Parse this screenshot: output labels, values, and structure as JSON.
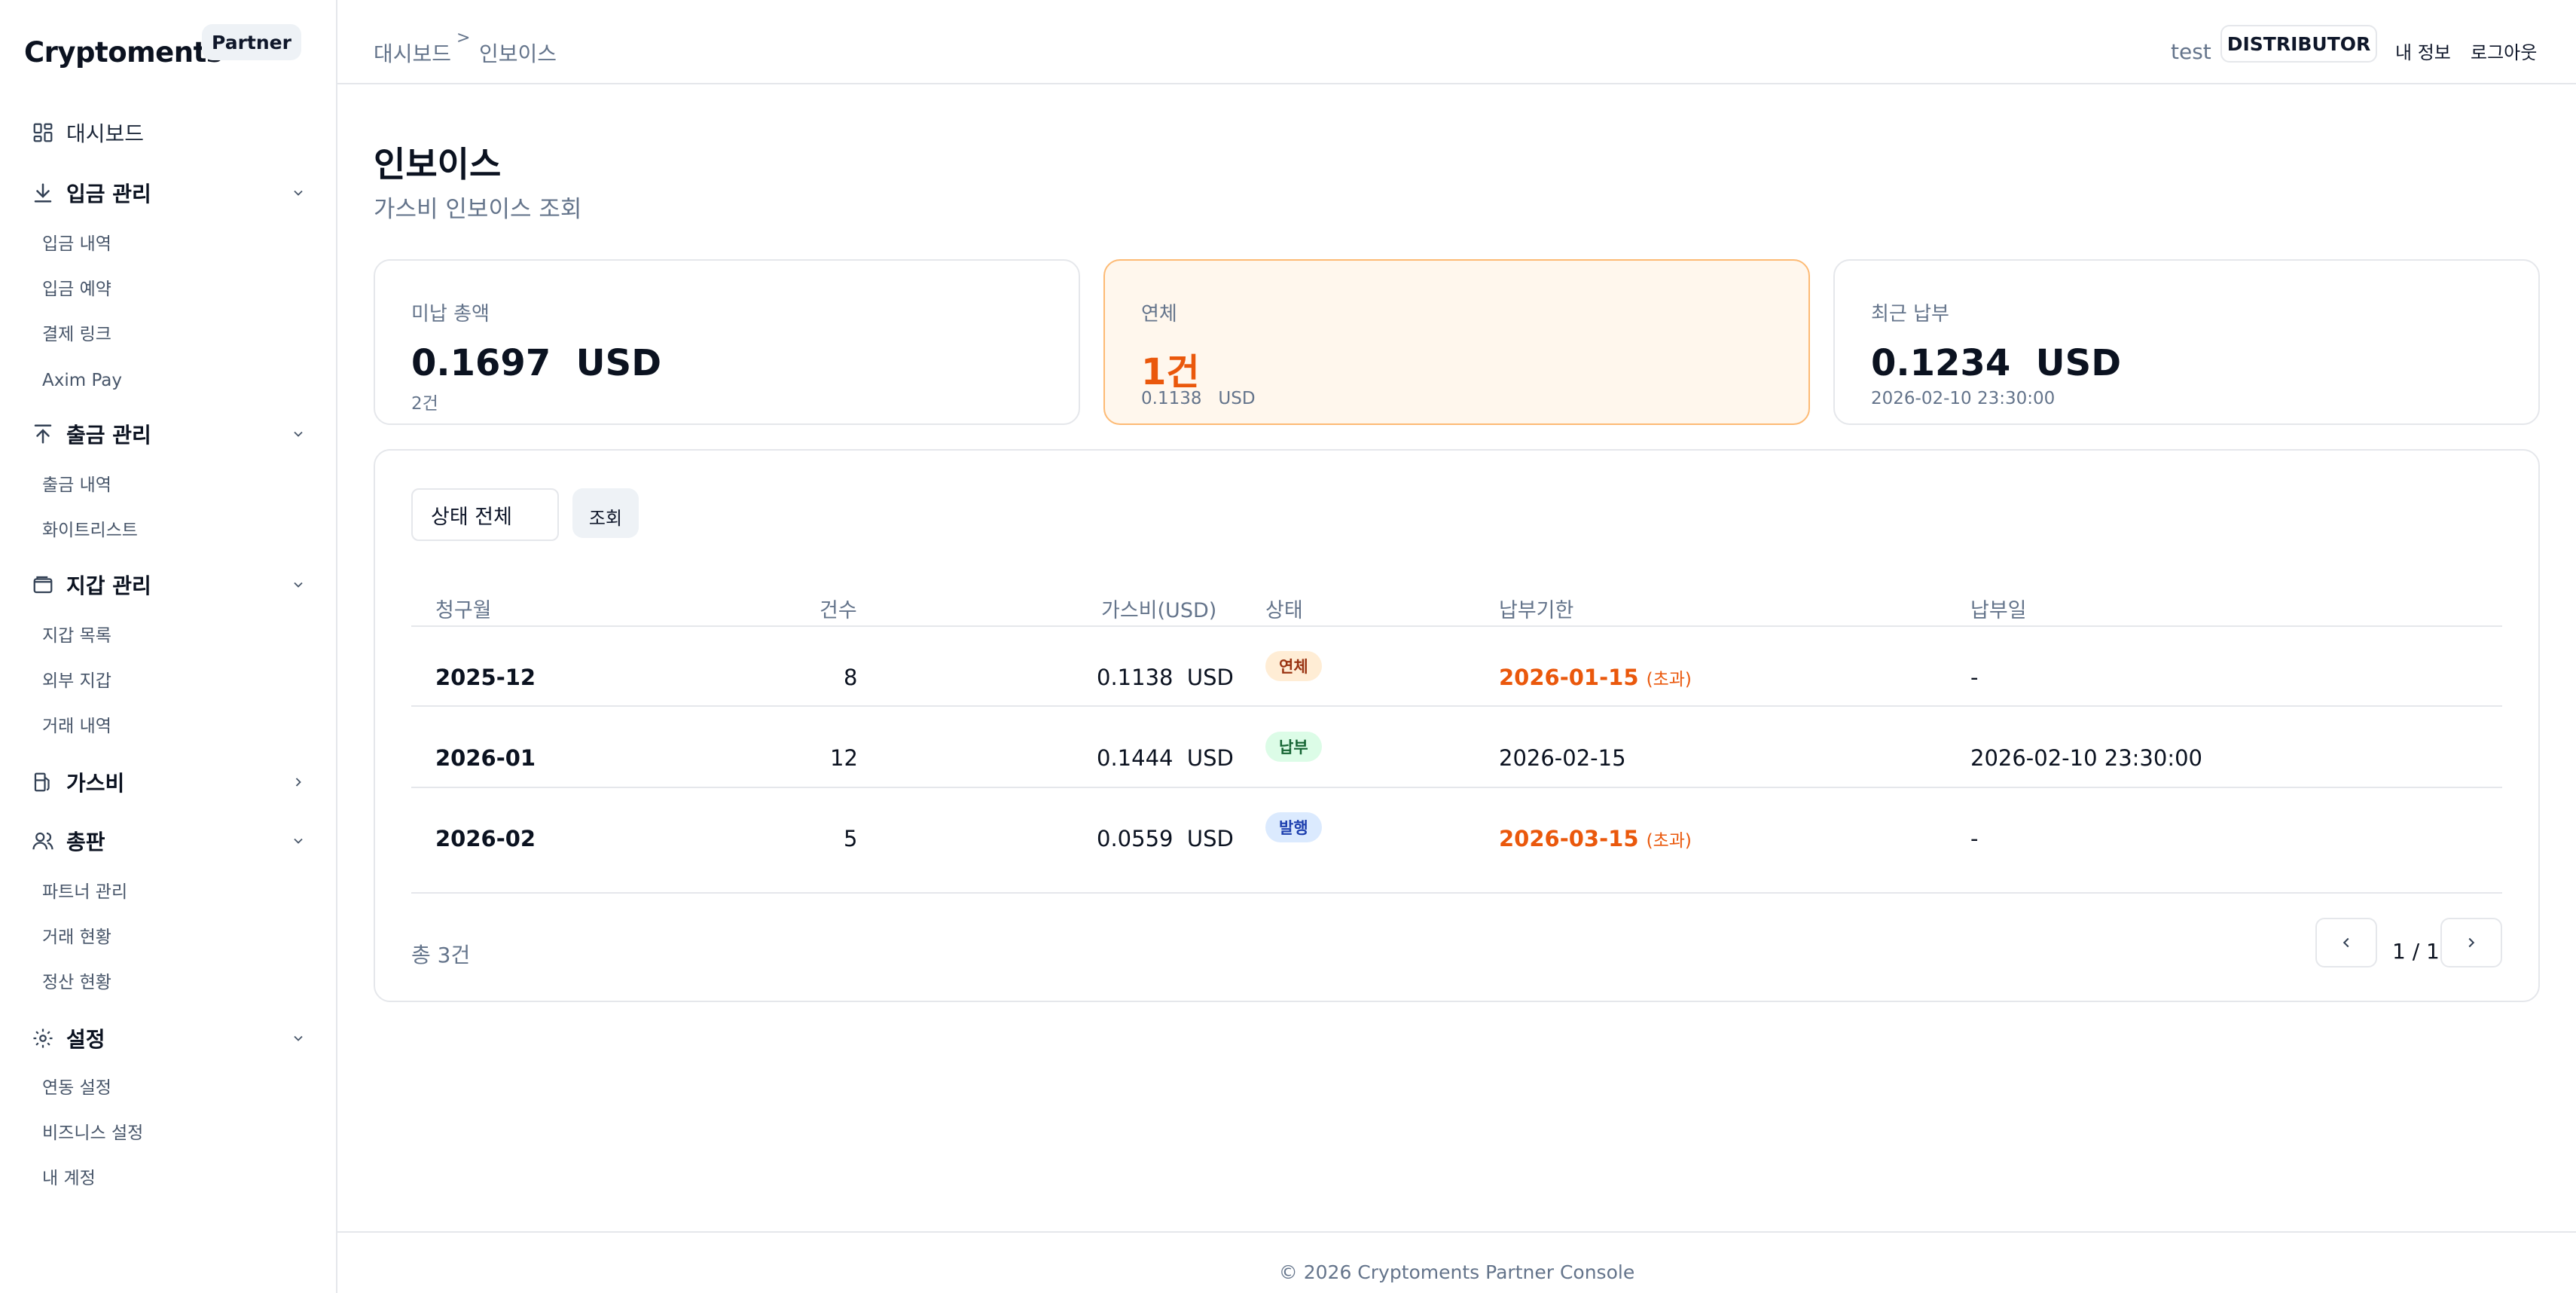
{
  "sidebar": {
    "brand": "Cryptoments",
    "badge": "Partner",
    "dashboard": "대시보드",
    "groups": [
      {
        "label": "입금 관리",
        "items": [
          "입금 내역",
          "입금 예약",
          "결제 링크",
          "Axim Pay"
        ]
      },
      {
        "label": "출금 관리",
        "items": [
          "출금 내역",
          "화이트리스트"
        ]
      },
      {
        "label": "지갑 관리",
        "items": [
          "지갑 목록",
          "외부 지갑",
          "거래 내역"
        ]
      },
      {
        "label": "가스비",
        "items": []
      },
      {
        "label": "총판",
        "items": [
          "파트너 관리",
          "거래 현황",
          "정산 현황"
        ]
      },
      {
        "label": "설정",
        "items": [
          "연동 설정",
          "비즈니스 설정",
          "내 계정"
        ]
      }
    ]
  },
  "header": {
    "breadcrumb": [
      "대시보드",
      "인보이스"
    ],
    "breadcrumb_sep": ">",
    "user": "test",
    "role": "DISTRIBUTOR",
    "my_info": "내 정보",
    "logout": "로그아웃"
  },
  "page": {
    "title": "인보이스",
    "subtitle": "가스비 인보이스 조회"
  },
  "cards": [
    {
      "label": "미납 총액",
      "value": "0.1697  USD",
      "sub": "2건"
    },
    {
      "label": "연체",
      "value": "1건",
      "sub": "0.1138   USD"
    },
    {
      "label": "최근 납부",
      "value": "0.1234  USD",
      "sub": "2026-02-10 23:30:00"
    }
  ],
  "filter": {
    "status_select": "상태 전체",
    "query_button": "조회"
  },
  "table": {
    "headers": [
      "청구월",
      "건수",
      "가스비(USD)",
      "상태",
      "납부기한",
      "납부일"
    ],
    "rows": [
      {
        "month": "2025-12",
        "count": "8",
        "fee": "0.1138  USD",
        "status": "연체",
        "due": "2026-01-15",
        "due_note": "(초과)",
        "paid": "-"
      },
      {
        "month": "2026-01",
        "count": "12",
        "fee": "0.1444  USD",
        "status": "납부",
        "due": "2026-02-15",
        "due_note": "",
        "paid": "2026-02-10 23:30:00"
      },
      {
        "month": "2026-02",
        "count": "5",
        "fee": "0.0559  USD",
        "status": "발행",
        "due": "2026-03-15",
        "due_note": "(초과)",
        "paid": "-"
      }
    ]
  },
  "pagination": {
    "total": "총 3건",
    "page": "1 / 1"
  },
  "footer": "© 2026 Cryptoments Partner Console",
  "colors": {
    "accent_orange": "#ea580c",
    "alert_bg": "#fff7ed",
    "border": "#e5e7eb"
  }
}
